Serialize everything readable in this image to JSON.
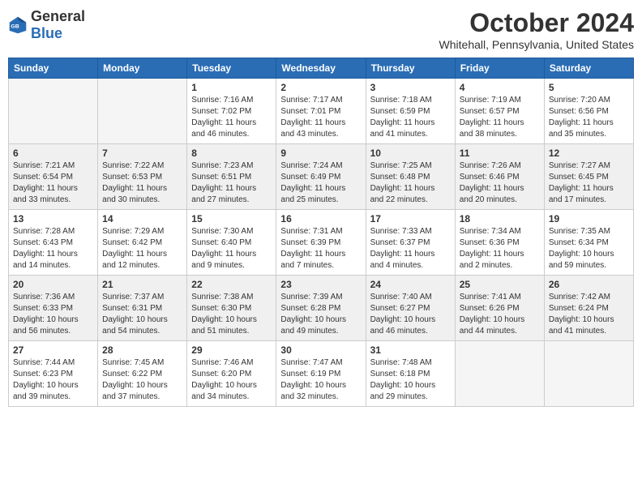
{
  "header": {
    "logo_general": "General",
    "logo_blue": "Blue",
    "month_title": "October 2024",
    "location": "Whitehall, Pennsylvania, United States"
  },
  "days_of_week": [
    "Sunday",
    "Monday",
    "Tuesday",
    "Wednesday",
    "Thursday",
    "Friday",
    "Saturday"
  ],
  "weeks": [
    [
      {
        "day": "",
        "info": ""
      },
      {
        "day": "",
        "info": ""
      },
      {
        "day": "1",
        "info": "Sunrise: 7:16 AM\nSunset: 7:02 PM\nDaylight: 11 hours and 46 minutes."
      },
      {
        "day": "2",
        "info": "Sunrise: 7:17 AM\nSunset: 7:01 PM\nDaylight: 11 hours and 43 minutes."
      },
      {
        "day": "3",
        "info": "Sunrise: 7:18 AM\nSunset: 6:59 PM\nDaylight: 11 hours and 41 minutes."
      },
      {
        "day": "4",
        "info": "Sunrise: 7:19 AM\nSunset: 6:57 PM\nDaylight: 11 hours and 38 minutes."
      },
      {
        "day": "5",
        "info": "Sunrise: 7:20 AM\nSunset: 6:56 PM\nDaylight: 11 hours and 35 minutes."
      }
    ],
    [
      {
        "day": "6",
        "info": "Sunrise: 7:21 AM\nSunset: 6:54 PM\nDaylight: 11 hours and 33 minutes."
      },
      {
        "day": "7",
        "info": "Sunrise: 7:22 AM\nSunset: 6:53 PM\nDaylight: 11 hours and 30 minutes."
      },
      {
        "day": "8",
        "info": "Sunrise: 7:23 AM\nSunset: 6:51 PM\nDaylight: 11 hours and 27 minutes."
      },
      {
        "day": "9",
        "info": "Sunrise: 7:24 AM\nSunset: 6:49 PM\nDaylight: 11 hours and 25 minutes."
      },
      {
        "day": "10",
        "info": "Sunrise: 7:25 AM\nSunset: 6:48 PM\nDaylight: 11 hours and 22 minutes."
      },
      {
        "day": "11",
        "info": "Sunrise: 7:26 AM\nSunset: 6:46 PM\nDaylight: 11 hours and 20 minutes."
      },
      {
        "day": "12",
        "info": "Sunrise: 7:27 AM\nSunset: 6:45 PM\nDaylight: 11 hours and 17 minutes."
      }
    ],
    [
      {
        "day": "13",
        "info": "Sunrise: 7:28 AM\nSunset: 6:43 PM\nDaylight: 11 hours and 14 minutes."
      },
      {
        "day": "14",
        "info": "Sunrise: 7:29 AM\nSunset: 6:42 PM\nDaylight: 11 hours and 12 minutes."
      },
      {
        "day": "15",
        "info": "Sunrise: 7:30 AM\nSunset: 6:40 PM\nDaylight: 11 hours and 9 minutes."
      },
      {
        "day": "16",
        "info": "Sunrise: 7:31 AM\nSunset: 6:39 PM\nDaylight: 11 hours and 7 minutes."
      },
      {
        "day": "17",
        "info": "Sunrise: 7:33 AM\nSunset: 6:37 PM\nDaylight: 11 hours and 4 minutes."
      },
      {
        "day": "18",
        "info": "Sunrise: 7:34 AM\nSunset: 6:36 PM\nDaylight: 11 hours and 2 minutes."
      },
      {
        "day": "19",
        "info": "Sunrise: 7:35 AM\nSunset: 6:34 PM\nDaylight: 10 hours and 59 minutes."
      }
    ],
    [
      {
        "day": "20",
        "info": "Sunrise: 7:36 AM\nSunset: 6:33 PM\nDaylight: 10 hours and 56 minutes."
      },
      {
        "day": "21",
        "info": "Sunrise: 7:37 AM\nSunset: 6:31 PM\nDaylight: 10 hours and 54 minutes."
      },
      {
        "day": "22",
        "info": "Sunrise: 7:38 AM\nSunset: 6:30 PM\nDaylight: 10 hours and 51 minutes."
      },
      {
        "day": "23",
        "info": "Sunrise: 7:39 AM\nSunset: 6:28 PM\nDaylight: 10 hours and 49 minutes."
      },
      {
        "day": "24",
        "info": "Sunrise: 7:40 AM\nSunset: 6:27 PM\nDaylight: 10 hours and 46 minutes."
      },
      {
        "day": "25",
        "info": "Sunrise: 7:41 AM\nSunset: 6:26 PM\nDaylight: 10 hours and 44 minutes."
      },
      {
        "day": "26",
        "info": "Sunrise: 7:42 AM\nSunset: 6:24 PM\nDaylight: 10 hours and 41 minutes."
      }
    ],
    [
      {
        "day": "27",
        "info": "Sunrise: 7:44 AM\nSunset: 6:23 PM\nDaylight: 10 hours and 39 minutes."
      },
      {
        "day": "28",
        "info": "Sunrise: 7:45 AM\nSunset: 6:22 PM\nDaylight: 10 hours and 37 minutes."
      },
      {
        "day": "29",
        "info": "Sunrise: 7:46 AM\nSunset: 6:20 PM\nDaylight: 10 hours and 34 minutes."
      },
      {
        "day": "30",
        "info": "Sunrise: 7:47 AM\nSunset: 6:19 PM\nDaylight: 10 hours and 32 minutes."
      },
      {
        "day": "31",
        "info": "Sunrise: 7:48 AM\nSunset: 6:18 PM\nDaylight: 10 hours and 29 minutes."
      },
      {
        "day": "",
        "info": ""
      },
      {
        "day": "",
        "info": ""
      }
    ]
  ]
}
